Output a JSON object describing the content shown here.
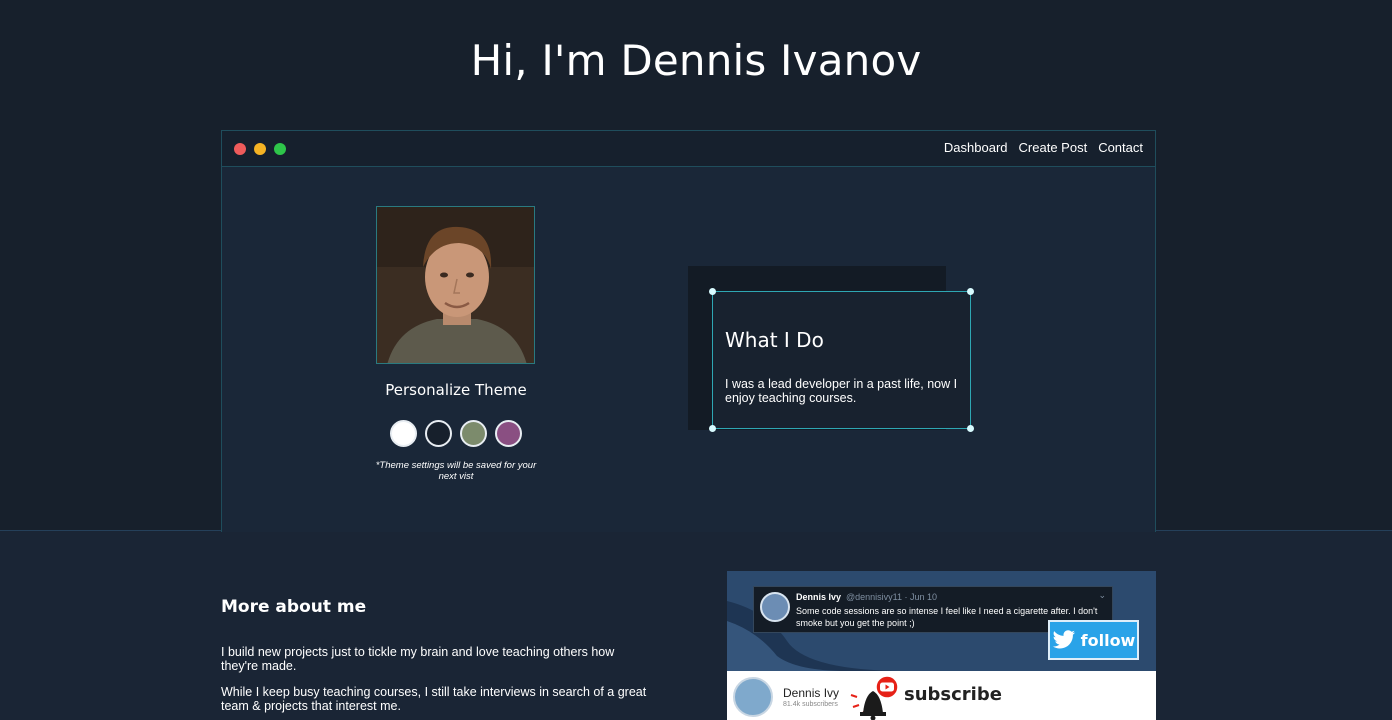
{
  "page": {
    "title": "Hi, I'm Dennis Ivanov"
  },
  "nav": {
    "items": [
      "Dashboard",
      "Create Post",
      "Contact"
    ]
  },
  "theme": {
    "title": "Personalize Theme",
    "note": "*Theme settings will be saved for your next vist",
    "swatches": [
      {
        "name": "light",
        "color": "#ffffff"
      },
      {
        "name": "dark",
        "color": "#17202c"
      },
      {
        "name": "green",
        "color": "#7c8b6c"
      },
      {
        "name": "purple",
        "color": "#8a4f82"
      }
    ]
  },
  "whatido": {
    "title": "What I Do",
    "text": "I was a lead developer in a past life, now I enjoy teaching courses."
  },
  "about": {
    "title": "More about me",
    "p1": "I build new projects just to tickle my brain and love teaching others how they're made.",
    "p2": "While I keep busy teaching courses, I still take interviews in search of a great team & projects that interest me."
  },
  "social": {
    "tweet": {
      "name": "Dennis Ivy",
      "meta": "@dennisivy11 · Jun 10",
      "text": "Some code sessions are so intense I feel like I need a cigarette after. I don't smoke but you get the point ;)"
    },
    "follow_label": "follow",
    "youtube": {
      "name": "Dennis Ivy",
      "subs": "81.4k subscribers",
      "subscribe_label": "subscribe"
    }
  },
  "colors": {
    "background": "#17202c",
    "accent": "#2ea7b3",
    "twitter": "#2aa3e8",
    "youtube": "#e62117"
  }
}
